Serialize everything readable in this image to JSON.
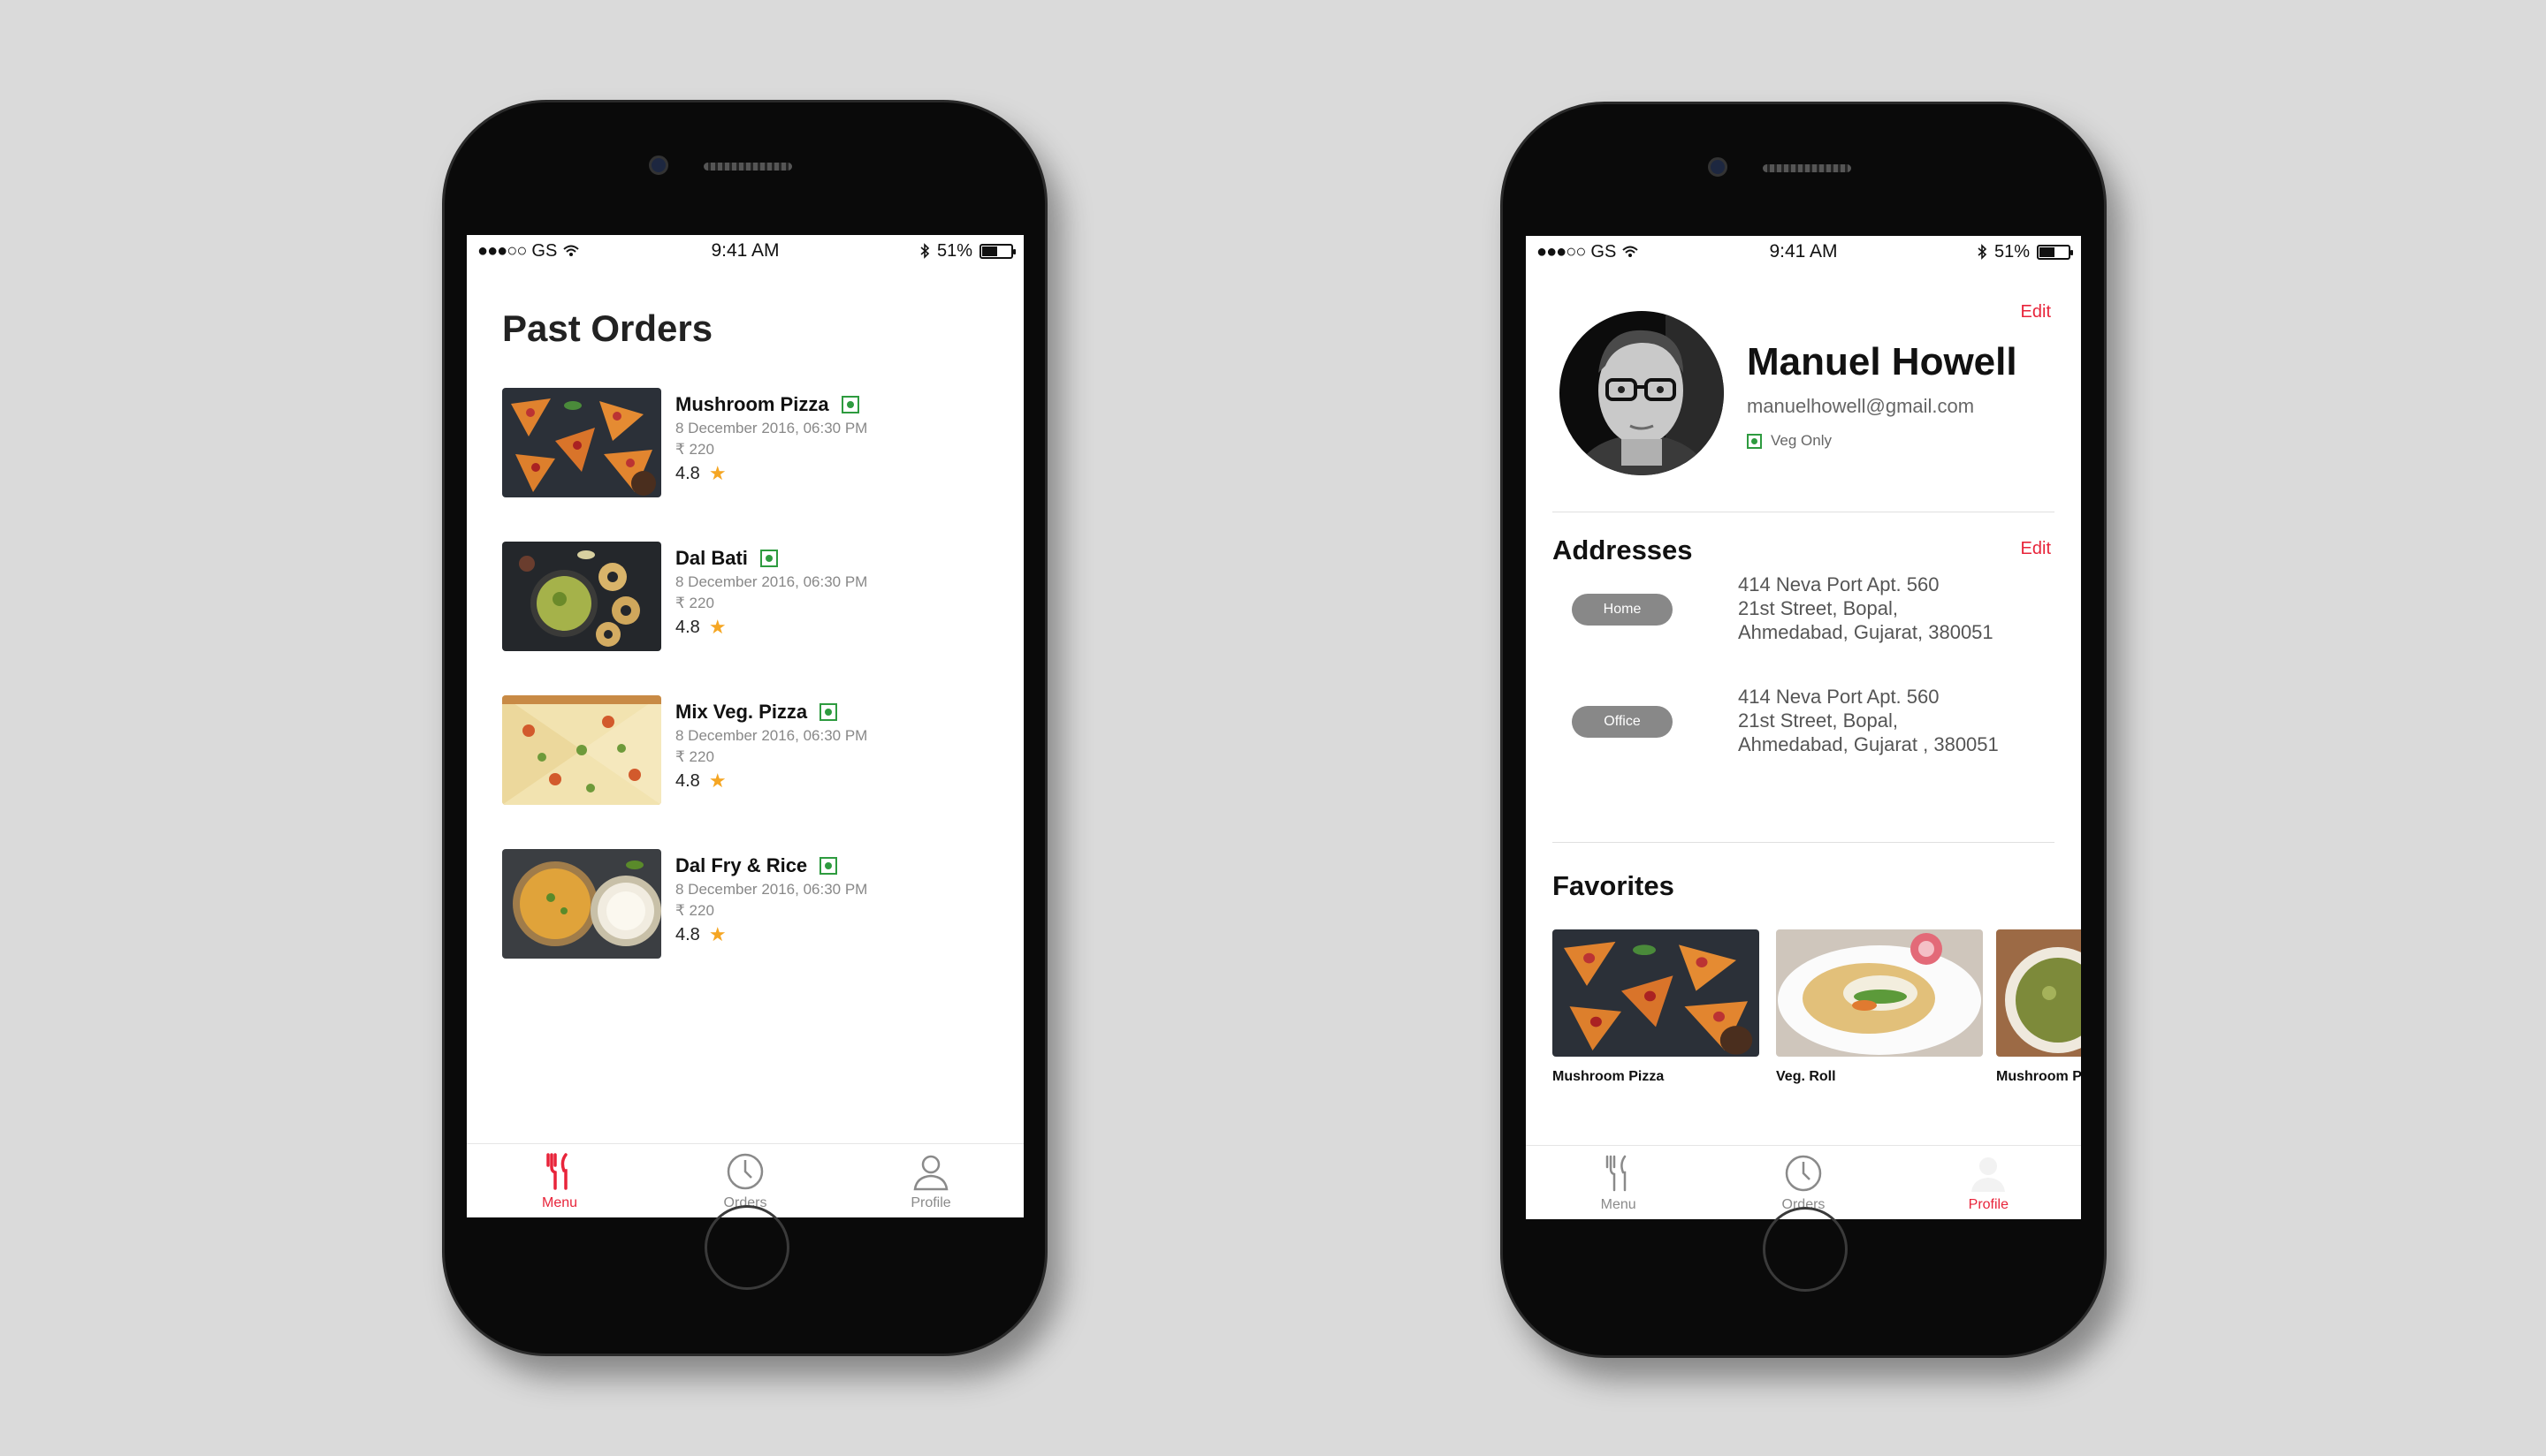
{
  "left_phone": {
    "status": {
      "carrier": "GS",
      "time": "9:41 AM",
      "battery": "51%"
    },
    "title": "Past Orders",
    "orders": [
      {
        "name": "Mushroom Pizza",
        "date": "8 December 2016, 06:30 PM",
        "price": "₹ 220",
        "rating": "4.8"
      },
      {
        "name": "Dal Bati",
        "date": "8 December 2016, 06:30 PM",
        "price": "₹ 220",
        "rating": "4.8"
      },
      {
        "name": "Mix Veg. Pizza",
        "date": "8 December 2016, 06:30 PM",
        "price": "₹ 220",
        "rating": "4.8"
      },
      {
        "name": "Dal Fry & Rice",
        "date": "8 December 2016, 06:30 PM",
        "price": "₹ 220",
        "rating": "4.8"
      }
    ],
    "tabs": [
      {
        "label": "Menu",
        "icon": "fork-knife-icon",
        "active": true
      },
      {
        "label": "Orders",
        "icon": "clock-icon",
        "active": false
      },
      {
        "label": "Profile",
        "icon": "user-icon",
        "active": false
      }
    ]
  },
  "right_phone": {
    "status": {
      "carrier": "GS",
      "time": "9:41 AM",
      "battery": "51%"
    },
    "profile": {
      "edit_label": "Edit",
      "name": "Manuel Howell",
      "email": "manuelhowell@gmail.com",
      "diet": "Veg Only"
    },
    "addresses": {
      "title": "Addresses",
      "edit_label": "Edit",
      "items": [
        {
          "tag": "Home",
          "line1": "414 Neva Port Apt. 560",
          "line2": "21st Street, Bopal,",
          "line3": "Ahmedabad, Gujarat, 380051"
        },
        {
          "tag": "Office",
          "line1": "414 Neva Port Apt. 560",
          "line2": "21st Street, Bopal,",
          "line3": "Ahmedabad, Gujarat , 380051"
        }
      ]
    },
    "favorites": {
      "title": "Favorites",
      "items": [
        {
          "label": "Mushroom Pizza"
        },
        {
          "label": "Veg. Roll"
        },
        {
          "label": "Mushroom Pizza"
        }
      ]
    },
    "tabs": [
      {
        "label": "Menu",
        "icon": "fork-knife-icon",
        "active": false
      },
      {
        "label": "Orders",
        "icon": "clock-icon",
        "active": false
      },
      {
        "label": "Profile",
        "icon": "user-icon",
        "active": true
      }
    ]
  },
  "colors": {
    "accent": "#e8243a",
    "veg_green": "#2e9b3f",
    "star": "#f5a623",
    "background": "#dadada"
  }
}
